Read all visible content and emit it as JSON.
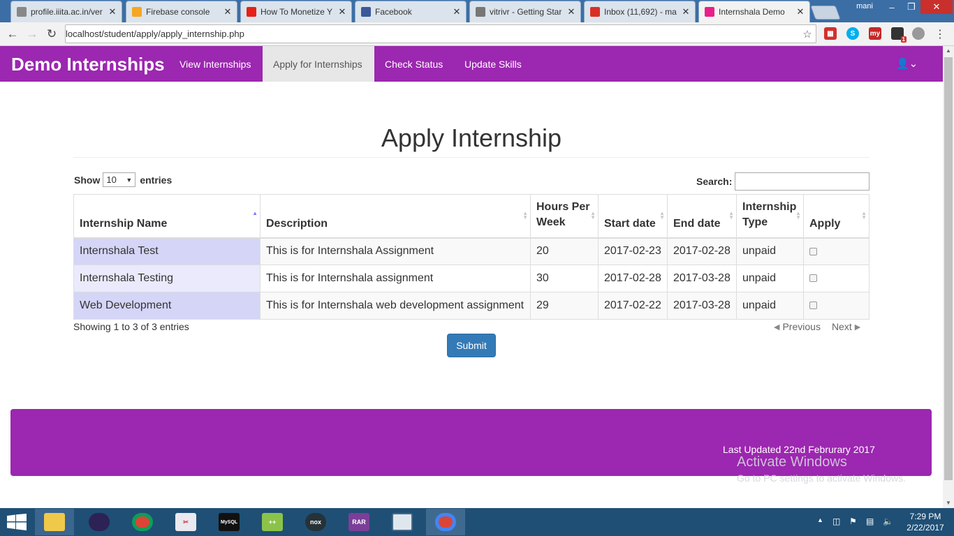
{
  "browser": {
    "tabs": [
      {
        "title": "profile.iiita.ac.in/ver",
        "icon": "page-icon",
        "color": "#888888"
      },
      {
        "title": "Firebase console",
        "icon": "firebase-icon",
        "color": "#f5a623"
      },
      {
        "title": "How To Monetize Y",
        "icon": "youtube-icon",
        "color": "#e62117"
      },
      {
        "title": "Facebook",
        "icon": "facebook-icon",
        "color": "#3b5998"
      },
      {
        "title": "vitrivr - Getting Star",
        "icon": "search-icon",
        "color": "#777777"
      },
      {
        "title": "Inbox (11,692) - ma",
        "icon": "gmail-icon",
        "color": "#d93025"
      },
      {
        "title": "Internshala Demo",
        "icon": "internshala-icon",
        "color": "#e91e8c"
      }
    ],
    "user": "mani",
    "url": "localhost/student/apply/apply_internship.php",
    "extension_badge": "1"
  },
  "navbar": {
    "brand": "Demo Internships",
    "links": [
      "View Internships",
      "Apply for Internships",
      "Check Status",
      "Update Skills"
    ],
    "active_index": 1,
    "accent": "#9c27b0"
  },
  "page": {
    "title": "Apply Internship",
    "show_label": "Show",
    "entries_label": "entries",
    "page_length": "10",
    "search_label": "Search:",
    "search_value": "",
    "columns": [
      "Internship Name",
      "Description",
      "Hours Per Week",
      "Start date",
      "End date",
      "Internship Type",
      "Apply"
    ],
    "rows": [
      {
        "name": "Internshala Test",
        "description": "This is for Internshala Assignment",
        "hours": "20",
        "start": "2017-02-23",
        "end": "2017-02-28",
        "type": "unpaid",
        "apply": false
      },
      {
        "name": "Internshala Testing",
        "description": "This is for Internshala assignment",
        "hours": "30",
        "start": "2017-02-28",
        "end": "2017-03-28",
        "type": "unpaid",
        "apply": false
      },
      {
        "name": "Web Development",
        "description": "This is for Internshala web development assignment",
        "hours": "29",
        "start": "2017-02-22",
        "end": "2017-03-28",
        "type": "unpaid",
        "apply": false
      }
    ],
    "info": "Showing 1 to 3 of 3 entries",
    "previous": "Previous",
    "next": "Next",
    "submit": "Submit",
    "submit_color": "#337ab7"
  },
  "footer": {
    "last_updated": "Last Updated 22nd Februrary 2017"
  },
  "watermark": {
    "line1": "Activate Windows",
    "line2": "Go to PC settings to activate Windows."
  },
  "taskbar": {
    "time": "7:29 PM",
    "date": "2/22/2017"
  }
}
